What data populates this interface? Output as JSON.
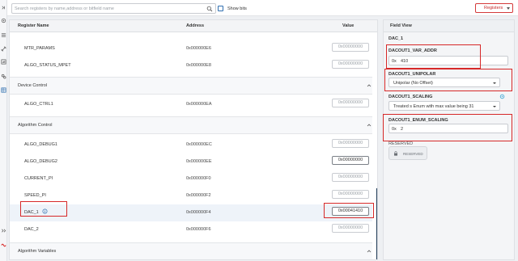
{
  "topbar": {
    "search_placeholder": "Search registers by name,address or bitfield name",
    "show_bits_label": "Show bits",
    "registers_button": "Registers"
  },
  "table": {
    "headers": {
      "name": "Register Name",
      "address": "Address",
      "value": "Value"
    },
    "rows_top": [
      {
        "name": "MTR_PARAMS",
        "address": "0x000000E6",
        "value": "0x00000000"
      },
      {
        "name": "ALGO_STATUS_MPET",
        "address": "0x000000E8",
        "value": "0x00000000"
      }
    ],
    "groups": {
      "device_control": "Device Control",
      "algorithm_control": "Algorithm Control",
      "algorithm_variables": "Algorithm Variables"
    },
    "rows_device": [
      {
        "name": "ALGO_CTRL1",
        "address": "0x000000EA",
        "value": "0x00000000"
      }
    ],
    "rows_algo": [
      {
        "name": "ALGO_DEBUG1",
        "address": "0x000000EC",
        "value": "0x00000000"
      },
      {
        "name": "ALGO_DEBUG2",
        "address": "0x000000EE",
        "value": "0x00000000"
      },
      {
        "name": "CURRENT_PI",
        "address": "0x000000F0",
        "value": "0x00000000"
      },
      {
        "name": "SPEED_PI",
        "address": "0x000000F2",
        "value": "0x00000000"
      },
      {
        "name": "DAC_1",
        "address": "0x000000F4",
        "value": "0x00041410"
      },
      {
        "name": "DAC_2",
        "address": "0x000000F6",
        "value": "0x00000000"
      }
    ]
  },
  "field_view": {
    "header": "Field View",
    "register": "DAC_1",
    "fields": {
      "var_addr": {
        "label": "DACOUT1_VAR_ADDR",
        "prefix": "0x",
        "value": "410"
      },
      "unipolar": {
        "label": "DACOUT1_UNIPOLAR",
        "selected": "Unipolar (No Offset)"
      },
      "scaling": {
        "label": "DACOUT1_SCALING",
        "selected": "Treated s Enum with max value being 31"
      },
      "enum_scaling": {
        "label": "DACOUT1_ENUM_SCALING",
        "prefix": "0x",
        "value": "2"
      },
      "reserved": {
        "label": "RESERVED",
        "badge": "RESERVED"
      }
    }
  },
  "colors": {
    "highlight": "#d62828",
    "accent": "#2f6fb0",
    "scrollbar": "#1f3b57"
  },
  "icons": [
    "search-icon",
    "chevron-up-icon",
    "info-icon",
    "gear-icon",
    "lock-icon",
    "caret-down-icon"
  ]
}
